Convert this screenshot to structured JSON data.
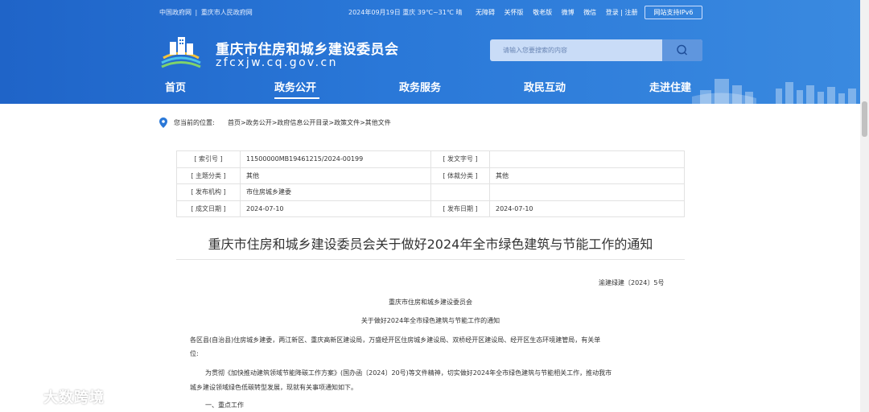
{
  "topbar": {
    "gov_links": [
      "中国政府网",
      "|",
      "重庆市人民政府网"
    ],
    "date_weather": "2024年09月19日  重庆  39℃~31℃ 晴",
    "links": [
      "无障碍",
      "关怀版",
      "敬老版",
      "微博",
      "微信",
      "登录 | 注册"
    ],
    "ipv6_label": "网站支持IPv6"
  },
  "site": {
    "title": "重庆市住房和城乡建设委员会",
    "url": "zfcxjw.cq.gov.cn"
  },
  "search": {
    "placeholder": "请输入您要搜索的内容"
  },
  "nav": {
    "items": [
      "首页",
      "政务公开",
      "政务服务",
      "政民互动",
      "走进住建"
    ],
    "active": "政务公开"
  },
  "breadcrumb": {
    "label": "您当前的位置:",
    "path": "首页>政务公开>政府信息公开目录>政策文件>其他文件"
  },
  "meta": {
    "rows": [
      [
        "[ 索引号 ]",
        "11500000MB19461215/2024-00199",
        "[ 发文字号 ]",
        ""
      ],
      [
        "[ 主题分类 ]",
        "其他",
        "[ 体裁分类 ]",
        "其他"
      ],
      [
        "[ 发布机构 ]",
        "市住房城乡建委",
        "",
        ""
      ],
      [
        "[ 成文日期 ]",
        "2024-07-10",
        "[ 发布日期 ]",
        "2024-07-10"
      ]
    ]
  },
  "article": {
    "title": "重庆市住房和城乡建设委员会关于做好2024年全市绿色建筑与节能工作的通知",
    "doc_no": "渝建绿建〔2024〕5号",
    "org": "重庆市住房和城乡建设委员会",
    "subtitle": "关于做好2024年全市绿色建筑与节能工作的通知",
    "addressee_line1": "各区县(自治县)住房城乡建委，两江新区、重庆高新区建设局，万盛经开区住房城乡建设局、双桥经开区建设局、经开区生态环境建管局，有关单",
    "addressee_line2": "位:",
    "body_line1": "为贯彻《加快推动建筑领域节能降碳工作方案》(国办函〔2024〕20号)等文件精神，切实做好2024年全市绿色建筑与节能相关工作，推动我市",
    "body_line2": "城乡建设领域绿色低碳转型发展，现就有关事项通知如下。",
    "section1": "一、重点工作"
  },
  "watermark": {
    "text": "大数跨境"
  },
  "colors": {
    "header_blue": "#2a78d8",
    "search_bg": "#c9dcf7",
    "search_btn": "#5f96de"
  }
}
